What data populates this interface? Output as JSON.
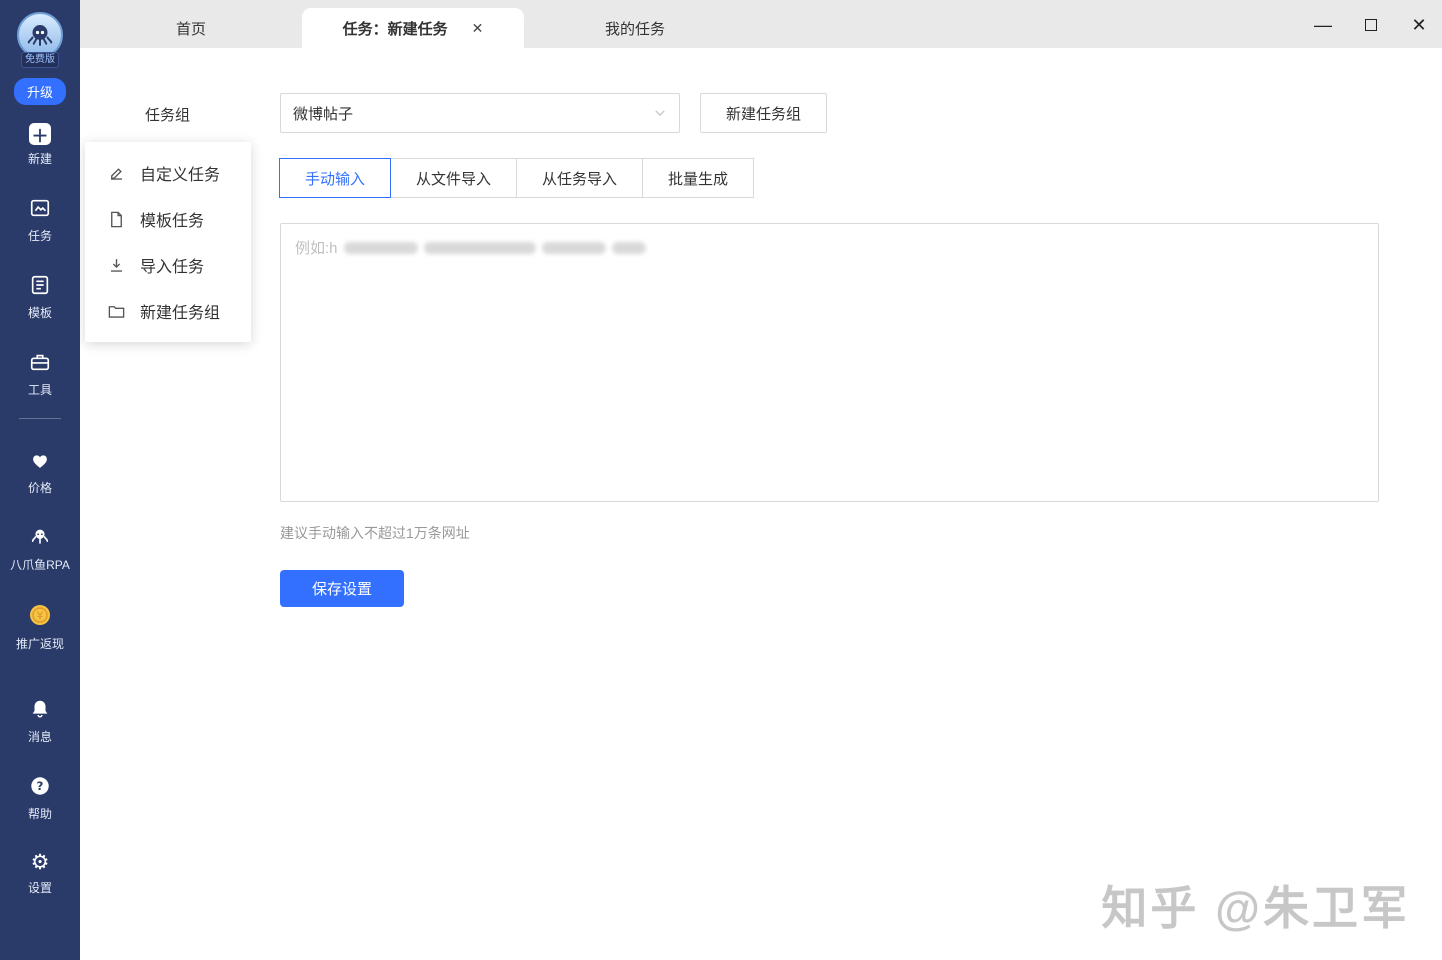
{
  "window": {
    "minimize_glyph": "—",
    "close_glyph": "✕"
  },
  "sidebar": {
    "badge": "免费版",
    "upgrade_label": "升级",
    "items": [
      {
        "label": "新建",
        "icon": "plus-icon"
      },
      {
        "label": "任务",
        "icon": "task-icon"
      },
      {
        "label": "模板",
        "icon": "template-icon"
      },
      {
        "label": "工具",
        "icon": "tools-icon"
      },
      {
        "label": "价格",
        "icon": "price-icon"
      },
      {
        "label": "八爪鱼RPA",
        "icon": "octopus-rpa-icon"
      },
      {
        "label": "推广返现",
        "icon": "gold-coin-icon"
      },
      {
        "label": "消息",
        "icon": "bell-icon"
      },
      {
        "label": "帮助",
        "icon": "help-icon"
      },
      {
        "label": "设置",
        "icon": "gear-icon"
      }
    ]
  },
  "tabs": [
    {
      "label": "首页",
      "active": false
    },
    {
      "label": "任务：新建任务",
      "active": true,
      "close_glyph": "✕"
    },
    {
      "label": "我的任务",
      "active": false
    }
  ],
  "main": {
    "task_group_label": "任务组",
    "task_group_value": "微博帖子",
    "new_task_group_button": "新建任务组",
    "menu_items": [
      {
        "label": "自定义任务",
        "icon": "edit-icon"
      },
      {
        "label": "模板任务",
        "icon": "file-icon"
      },
      {
        "label": "导入任务",
        "icon": "import-icon"
      },
      {
        "label": "新建任务组",
        "icon": "folder-icon"
      }
    ],
    "input_tabs": [
      "手动输入",
      "从文件导入",
      "从任务导入",
      "批量生成"
    ],
    "active_input_tab": "手动输入",
    "url_placeholder_prefix": "例如:h",
    "hint": "建议手动输入不超过1万条网址",
    "save_button": "保存设置"
  },
  "watermark": "知乎 @朱卫军",
  "colors": {
    "sidebar_bg": "#2a3b69",
    "accent_blue": "#3370ff",
    "tabbar_bg": "#e9e9e9",
    "coin_gold": "#f6c344"
  }
}
